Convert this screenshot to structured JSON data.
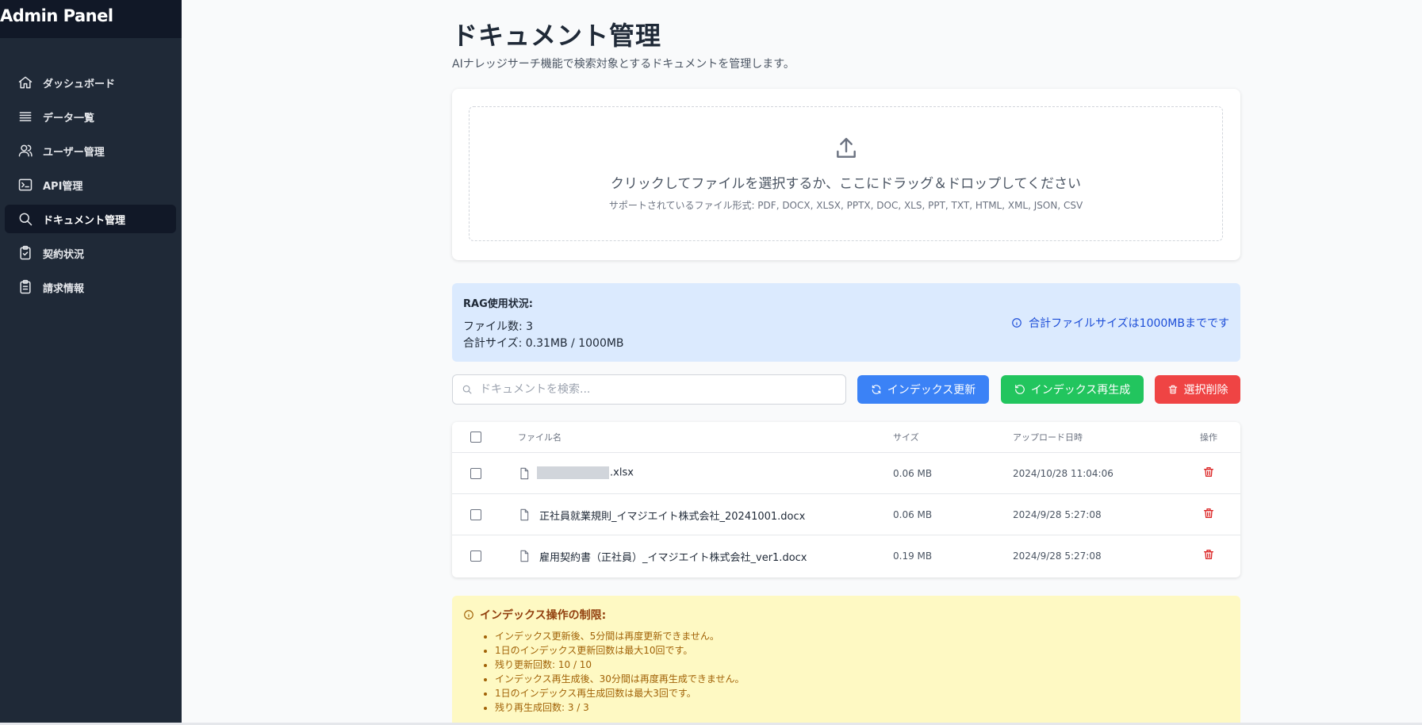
{
  "sidebar": {
    "brand": "Admin Panel",
    "items": [
      {
        "label": "ダッシュボード",
        "icon": "home-icon",
        "active": false
      },
      {
        "label": "データ一覧",
        "icon": "list-icon",
        "active": false
      },
      {
        "label": "ユーザー管理",
        "icon": "users-icon",
        "active": false
      },
      {
        "label": "API管理",
        "icon": "terminal-icon",
        "active": false
      },
      {
        "label": "ドキュメント管理",
        "icon": "search-icon",
        "active": true
      },
      {
        "label": "契約状況",
        "icon": "clipboard-check-icon",
        "active": false
      },
      {
        "label": "請求情報",
        "icon": "clipboard-list-icon",
        "active": false
      }
    ]
  },
  "page": {
    "title": "ドキュメント管理",
    "subtitle": "AIナレッジサーチ機能で検索対象とするドキュメントを管理します。"
  },
  "upload": {
    "prompt": "クリックしてファイルを選択するか、ここにドラッグ＆ドロップしてください",
    "supported": "サポートされているファイル形式: PDF, DOCX, XLSX, PPTX, DOC, XLS, PPT, TXT, HTML, XML, JSON, CSV"
  },
  "usage": {
    "title": "RAG使用状況:",
    "file_count": "ファイル数: 3",
    "total_size": "合計サイズ: 0.31MB / 1000MB",
    "note": "合計ファイルサイズは1000MBまでです"
  },
  "toolbar": {
    "search_placeholder": "ドキュメントを検索...",
    "update_label": "インデックス更新",
    "rebuild_label": "インデックス再生成",
    "delete_label": "選択削除"
  },
  "table": {
    "headers": {
      "name": "ファイル名",
      "size": "サイズ",
      "date": "アップロード日時",
      "actions": "操作"
    },
    "rows": [
      {
        "name": ".xlsx",
        "redacted": true,
        "size": "0.06 MB",
        "date": "2024/10/28 11:04:06"
      },
      {
        "name": "正社員就業規則_イマジエイト株式会社_20241001.docx",
        "redacted": false,
        "size": "0.06 MB",
        "date": "2024/9/28 5:27:08"
      },
      {
        "name": "雇用契約書（正社員）_イマジエイト株式会社_ver1.docx",
        "redacted": false,
        "size": "0.19 MB",
        "date": "2024/9/28 5:27:08"
      }
    ]
  },
  "limits": {
    "title": "インデックス操作の制限:",
    "items": [
      "インデックス更新後、5分間は再度更新できません。",
      "1日のインデックス更新回数は最大10回です。",
      "残り更新回数: 10 / 10",
      "インデックス再生成後、30分間は再度再生成できません。",
      "1日のインデックス再生成回数は最大3回です。",
      "残り再生成回数: 3 / 3"
    ]
  },
  "colors": {
    "sidebar_bg": "#1f2937",
    "sidebar_active": "#111827",
    "info_bg": "#dbeafe",
    "warning_bg": "#fef9c3",
    "primary": "#3b82f6",
    "success": "#22c55e",
    "danger": "#ef4444"
  }
}
